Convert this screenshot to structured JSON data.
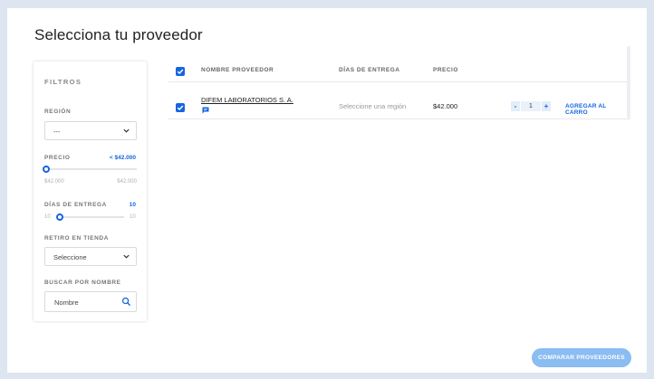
{
  "page": {
    "title": "Selecciona tu proveedor"
  },
  "filters": {
    "title": "FILTROS",
    "region": {
      "label": "REGIÓN",
      "selected": "---"
    },
    "price": {
      "label": "PRECIO",
      "value": "< $42.000",
      "min": "$42.000",
      "max": "$42.000",
      "level": 0
    },
    "delivery": {
      "label": "DÍAS DE ENTREGA",
      "value": "10",
      "min": "10",
      "max": "10",
      "level": 0
    },
    "pickup": {
      "label": "RETIRO EN TIENDA",
      "selected": "Seleccione"
    },
    "search": {
      "label": "BUSCAR POR NOMBRE",
      "placeholder": "Nombre"
    }
  },
  "table": {
    "columns": {
      "name": "NOMBRE PROVEEDOR",
      "delivery": "DÍAS DE ENTREGA",
      "price": "PRECIO"
    },
    "rows": [
      {
        "name": "DIFEM LABORATORIOS S. A.",
        "delivery": "Seleccione una región",
        "price": "$42.000",
        "qty": "1",
        "minus": "-",
        "plus": "+",
        "action": "AGREGAR AL CARRO",
        "checked": true
      }
    ]
  },
  "compare_button": "COMPARAR PROVEEDORES",
  "colors": {
    "accent": "#1565e0",
    "background": "#dde5f0",
    "compare_button": "#8bbcf2"
  }
}
